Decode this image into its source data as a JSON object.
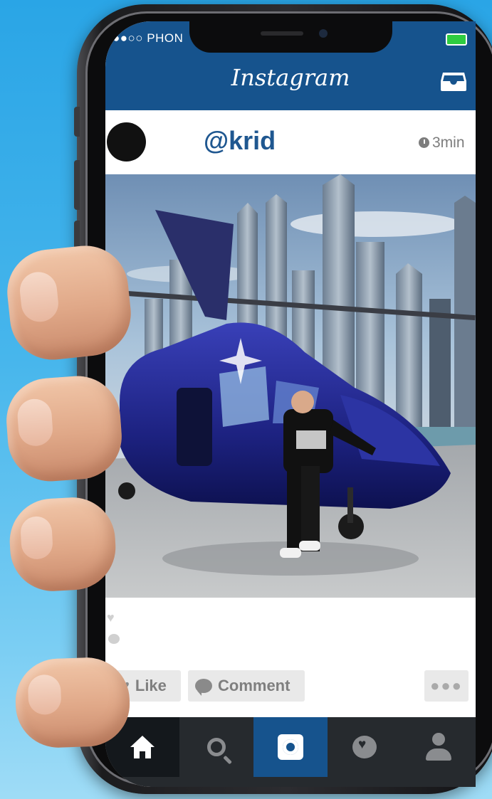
{
  "status_bar": {
    "carrier": "●●○○ PHON",
    "battery_color": "#2ecc40"
  },
  "header": {
    "logo_text": "Instagram",
    "inbox_icon": "inbox-tray-icon",
    "background": "#16538d"
  },
  "post": {
    "username": "@krid",
    "time": "3min",
    "time_icon": "clock-icon",
    "actions": {
      "like_label": "Like",
      "comment_label": "Comment",
      "more_label": "●●●"
    }
  },
  "bottom_nav": {
    "items": [
      {
        "name": "home",
        "icon": "home-icon",
        "active": true
      },
      {
        "name": "search",
        "icon": "search-icon",
        "active": false
      },
      {
        "name": "camera",
        "icon": "camera-icon",
        "active": false
      },
      {
        "name": "activity",
        "icon": "heart-bubble-icon",
        "active": false
      },
      {
        "name": "profile",
        "icon": "person-icon",
        "active": false
      }
    ]
  }
}
